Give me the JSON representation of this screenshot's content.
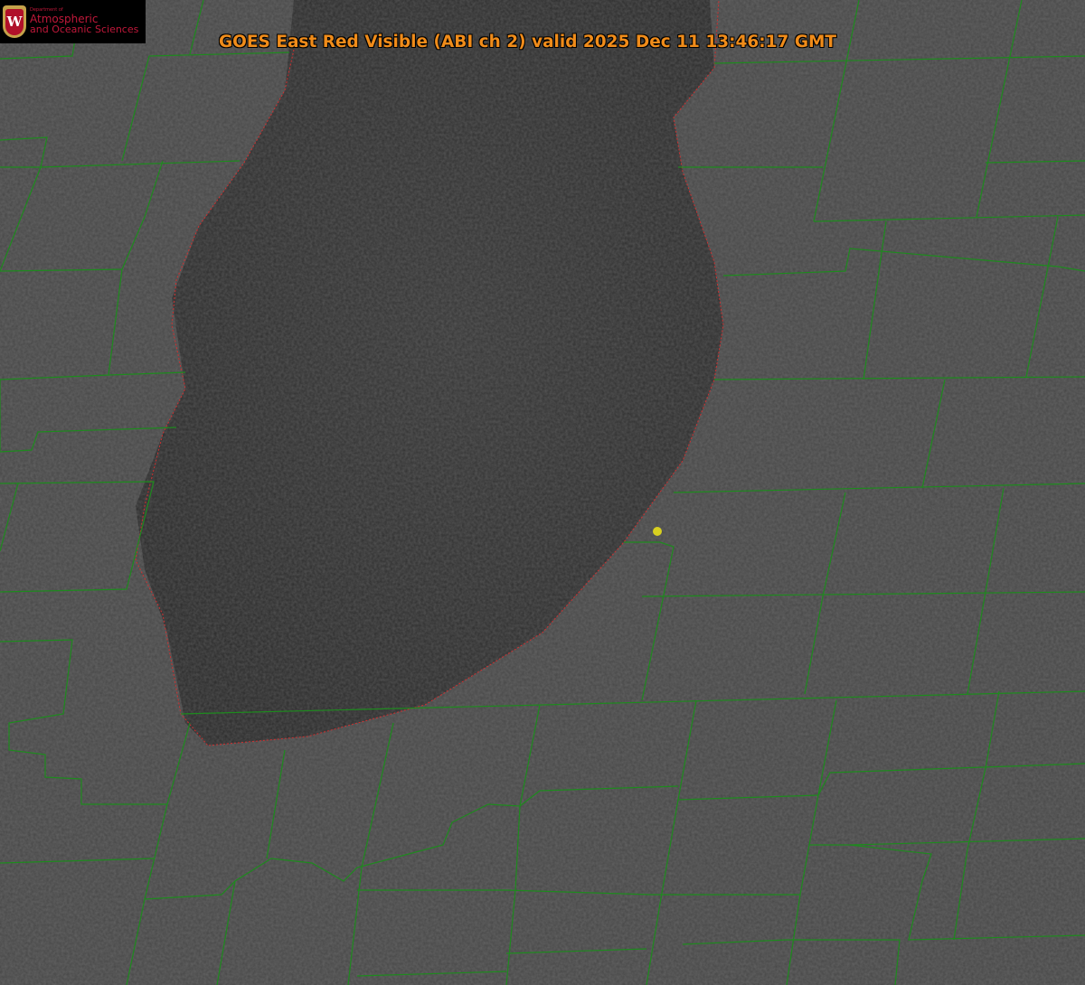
{
  "logo": {
    "line1": "Department of",
    "line2": "Atmospheric",
    "line3": "and Oceanic Sciences",
    "shield_letter": "W"
  },
  "title": "GOES East Red Visible (ABI ch 2) valid 2025 Dec 11 13:46:17 GMT",
  "colors": {
    "land": "#4a4a4a",
    "lake": "#2e2e2e",
    "county_lines": "#1e8a1e",
    "shoreline": "#d03030",
    "marker": "#d8d020",
    "title": "#f08c1a"
  }
}
